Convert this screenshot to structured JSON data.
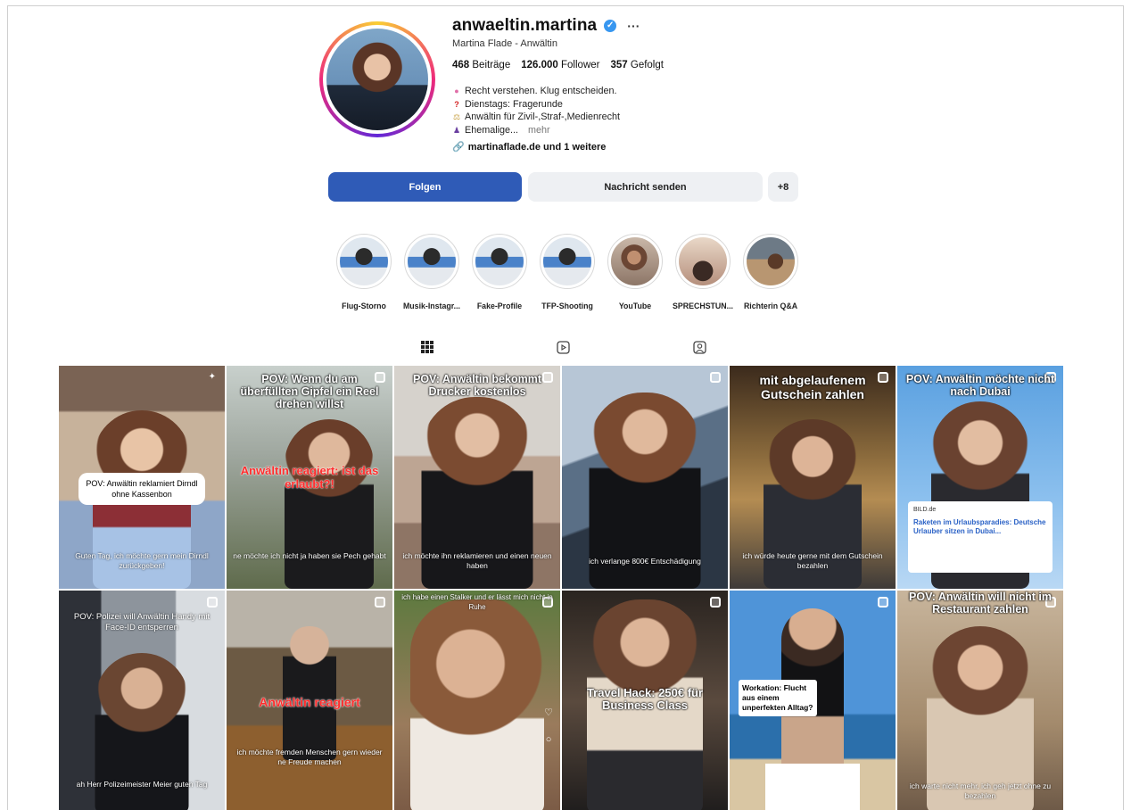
{
  "profile": {
    "username": "anwaeltin.martina",
    "full_name": "Martina Flade - Anwältin",
    "stats": {
      "posts_count": "468",
      "posts_label": "Beiträge",
      "followers_count": "126.000",
      "followers_label": "Follower",
      "following_count": "357",
      "following_label": "Gefolgt"
    },
    "bio": [
      {
        "icon": "brain-icon",
        "glyph": "●",
        "color": "#e06ea8",
        "text": "Recht verstehen. Klug entscheiden."
      },
      {
        "icon": "question-mark-icon",
        "glyph": "?",
        "color": "#d32020",
        "text": "Dienstags: Fragerunde"
      },
      {
        "icon": "scales-icon",
        "glyph": "⚖",
        "color": "#c8a040",
        "text": "Anwältin für Zivil-,Straf-,Medienrecht"
      },
      {
        "icon": "judge-icon",
        "glyph": "♟",
        "color": "#6a3fa0",
        "text": "Ehemalige..."
      }
    ],
    "bio_more": "mehr",
    "link_text": "martinaflade.de und 1 weitere"
  },
  "actions": {
    "follow": "Folgen",
    "message": "Nachricht senden",
    "add_user_glyph": "+8"
  },
  "highlights": [
    {
      "label": "Flug-Storno"
    },
    {
      "label": "Musik-Instagr..."
    },
    {
      "label": "Fake-Profile"
    },
    {
      "label": "TFP-Shooting"
    },
    {
      "label": "YouTube"
    },
    {
      "label": "SPRECHSTUN..."
    },
    {
      "label": "Richterin Q&A"
    }
  ],
  "posts": [
    {
      "top": "",
      "red": "",
      "box": "POV:  Anwältin reklamiert Dirndl ohne Kassenbon",
      "bottom": "Guten Tag, ich möchte gern mein Dirndl zurückgeben!"
    },
    {
      "top": "POV: Wenn du am überfüllten Gipfel ein Reel drehen willst",
      "red": "Anwältin reagiert: ist das erlaubt?!",
      "box": "",
      "bottom": "ne möchte ich nicht ja haben sie Pech gehabt"
    },
    {
      "top": "POV: Anwältin bekommt Drucker kostenlos",
      "red": "",
      "box": "",
      "bottom": "ich möchte ihn reklamieren und einen neuen haben"
    },
    {
      "top": "",
      "red": "",
      "box": "",
      "bottom": "ich verlange 800€ Entschädigung"
    },
    {
      "top": "mit abgelaufenem Gutschein zahlen",
      "red": "",
      "box": "",
      "bottom": "ich würde heute gerne mit dem Gutschein bezahlen"
    },
    {
      "top": "POV: Anwältin möchte nicht nach Dubai",
      "red": "",
      "box": "",
      "bottom": "",
      "news_source": "BILD.de",
      "news_headline": "Raketen im Urlaubsparadies: Deutsche Urlauber sitzen in Dubai..."
    },
    {
      "top": "POV: Polizei will Anwältin Handy mit Face-ID entsperren",
      "red": "",
      "box": "",
      "bottom": "ah Herr Polizeimeister Meier guten Tag"
    },
    {
      "top": "",
      "red": "Anwältin reagiert",
      "box": "",
      "bottom": "ich möchte fremden Menschen gern wieder ne Freude machen"
    },
    {
      "top": "ich habe einen Stalker und er lässt mich nicht in Ruhe",
      "red": "",
      "box": "",
      "bottom": ""
    },
    {
      "top": "Travel Hack: 250€ für Business Class",
      "red": "",
      "box": "",
      "bottom": ""
    },
    {
      "top": "",
      "red": "",
      "box": "",
      "bottom": "",
      "work_box": "Workation: Flucht aus einem unperfekten Alltag?"
    },
    {
      "top": "POV: Anwältin will nicht im Restaurant zahlen",
      "red": "",
      "box": "",
      "bottom": "ich warte nicht mehr, ich geh jetzt ohne zu bezahlen"
    }
  ],
  "colors": {
    "follow_button": "#2f5bb7",
    "secondary_button": "#eef0f3",
    "verified_badge": "#3897f0"
  }
}
